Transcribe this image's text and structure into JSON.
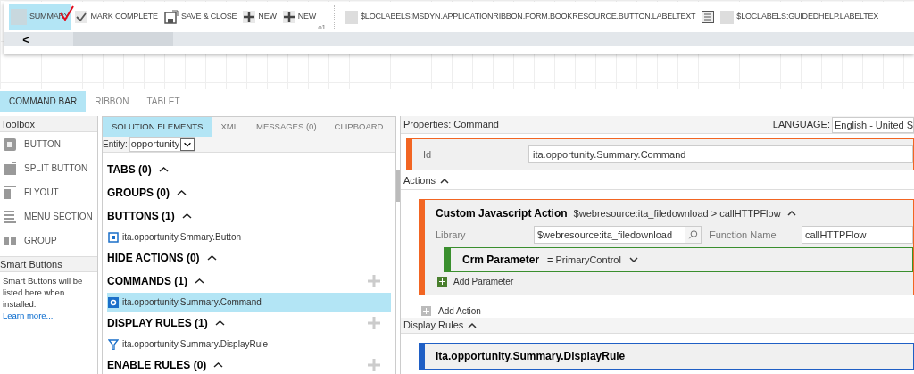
{
  "preview": {
    "toolbar": [
      {
        "kind": "summary",
        "label": "SUMMARY",
        "selected": true
      },
      {
        "kind": "check",
        "label": "MARK COMPLETE",
        "selected": false
      },
      {
        "kind": "save",
        "label": "SAVE & CLOSE",
        "selected": false
      },
      {
        "kind": "plus",
        "label": "NEW",
        "selected": false
      },
      {
        "kind": "plus",
        "label": "NEW",
        "note": "o1",
        "selected": false
      },
      {
        "kind": "divider"
      },
      {
        "kind": "blank",
        "label": "$LOCLABELS:MSDYN.APPLICATIONRIBBON.FORM.BOOKRESOURCE.BUTTON.LABELTEXT",
        "selected": false
      },
      {
        "kind": "form",
        "selected": false
      },
      {
        "kind": "blank",
        "label": "$LOCLABELS:GUIDEDHELP.LABELTEX",
        "selected": false
      }
    ],
    "scroll_left": "<"
  },
  "designer_tabs": [
    {
      "label": "COMMAND BAR",
      "selected": true
    },
    {
      "label": "RIBBON",
      "selected": false
    },
    {
      "label": "TABLET",
      "selected": false
    }
  ],
  "toolbox": {
    "title": "Toolbox",
    "items": [
      {
        "kind": "button",
        "label": "BUTTON"
      },
      {
        "kind": "split",
        "label": "SPLIT BUTTON"
      },
      {
        "kind": "flyout",
        "label": "FLYOUT"
      },
      {
        "kind": "menu",
        "label": "MENU SECTION"
      },
      {
        "kind": "group",
        "label": "GROUP"
      }
    ],
    "smart_title": "Smart Buttons",
    "smart_text": "Smart Buttons will be listed here when installed.",
    "smart_link": "Learn more..."
  },
  "solution": {
    "tabs": [
      {
        "label": "SOLUTION ELEMENTS",
        "selected": true
      },
      {
        "label": "XML",
        "selected": false
      },
      {
        "label": "MESSAGES (0)",
        "selected": false
      },
      {
        "label": "CLIPBOARD",
        "selected": false
      }
    ],
    "entity_label": "Entity:",
    "entity_value": "opportunity",
    "sections": [
      {
        "title": "TABS (0)",
        "addable": false
      },
      {
        "title": "GROUPS (0)",
        "addable": false
      },
      {
        "title": "BUTTONS (1)",
        "addable": false,
        "items": [
          {
            "kind": "button",
            "label": "ita.opportunity.Smmary.Button",
            "selected": false
          }
        ]
      },
      {
        "title": "HIDE ACTIONS (0)",
        "addable": false
      },
      {
        "title": "COMMANDS (1)",
        "addable": true,
        "items": [
          {
            "kind": "command",
            "label": "ita.opportunity.Summary.Command",
            "selected": true
          }
        ]
      },
      {
        "title": "DISPLAY RULES (1)",
        "addable": true,
        "items": [
          {
            "kind": "rule",
            "label": "ita.opportunity.Summary.DisplayRule",
            "selected": false
          }
        ]
      },
      {
        "title": "ENABLE RULES (0)",
        "addable": true
      }
    ]
  },
  "properties": {
    "title": "Properties: Command",
    "language_label": "LANGUAGE:",
    "language_value": "English - United S",
    "id_label": "Id",
    "id_value": "ita.opportunity.Summary.Command",
    "actions_title": "Actions",
    "action": {
      "title": "Custom Javascript Action",
      "detail": "$webresource:ita_filedownload > callHTTPFlow",
      "library_label": "Library",
      "library_value": "$webresource:ita_filedownload",
      "function_label": "Function Name",
      "function_value": "callHTTPFlow",
      "parameter_title": "Crm Parameter",
      "parameter_value": "= PrimaryControl",
      "add_parameter": "Add Parameter"
    },
    "add_action": "Add Action",
    "display_rules_title": "Display Rules",
    "display_rule": "ita.opportunity.Summary.DisplayRule"
  }
}
